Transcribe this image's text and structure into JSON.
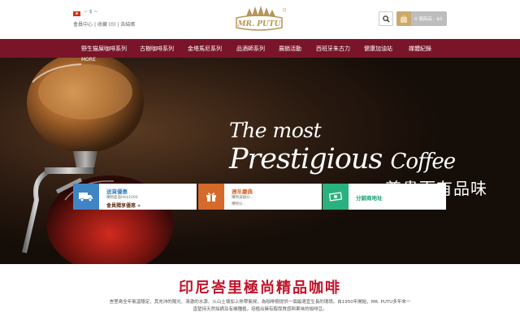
{
  "topbar": {
    "currency": "~ $ ~",
    "links": {
      "member_center": "會員中心",
      "sep1": "|",
      "favorites": "收藏 (0)",
      "sep2": "|",
      "checkout": "去結賬"
    }
  },
  "logo": {
    "text": "MR. PUTU"
  },
  "header": {
    "cart_label": "0 個商品 - $0"
  },
  "nav": {
    "items": [
      "野生猫屎咖啡系列",
      "古樹咖啡系列",
      "金塔馬尼系列",
      "品酒師系列",
      "展銷活動",
      "西班牙朱古力",
      "健康加油站",
      "媒體紀錄"
    ],
    "more": "MORE"
  },
  "hero": {
    "line1": "The most",
    "line2": "Prestigious",
    "line2b": "Coffee",
    "line3": "尊貴而有品味"
  },
  "promos": [
    {
      "title": "送貨優惠",
      "sub": "購物超過HK$1000",
      "sub2": "會員獨享優惠 »",
      "icon": "delivery-truck-icon",
      "color": "#3f85c4"
    },
    {
      "title": "週年慶典",
      "sub": "購物滿額分...",
      "sub2": "購物分...",
      "icon": "gift-icon",
      "color": "#d56a2a"
    },
    {
      "title": "分銷商地址",
      "icon": "money-icon",
      "color": "#2bb17d"
    }
  ],
  "section": {
    "heading": "印尼峇里極尚精品咖啡",
    "desc1": "峇里島全年氣溫穩定，其充沛的陽光、清澈的水源、火山土壤加上熱帶氣候，為咖啡樹提供一個最適宜生長的環境。自1950年開始，MR. PUTU多年來一",
    "desc2": "直堅持天然採摘及有機種植，培植出擁有醇厚質感與果味的咖啡豆。"
  },
  "colors": {
    "nav_bg": "#7a1529",
    "heading": "#c0142b",
    "gold": "#c9a96e"
  }
}
